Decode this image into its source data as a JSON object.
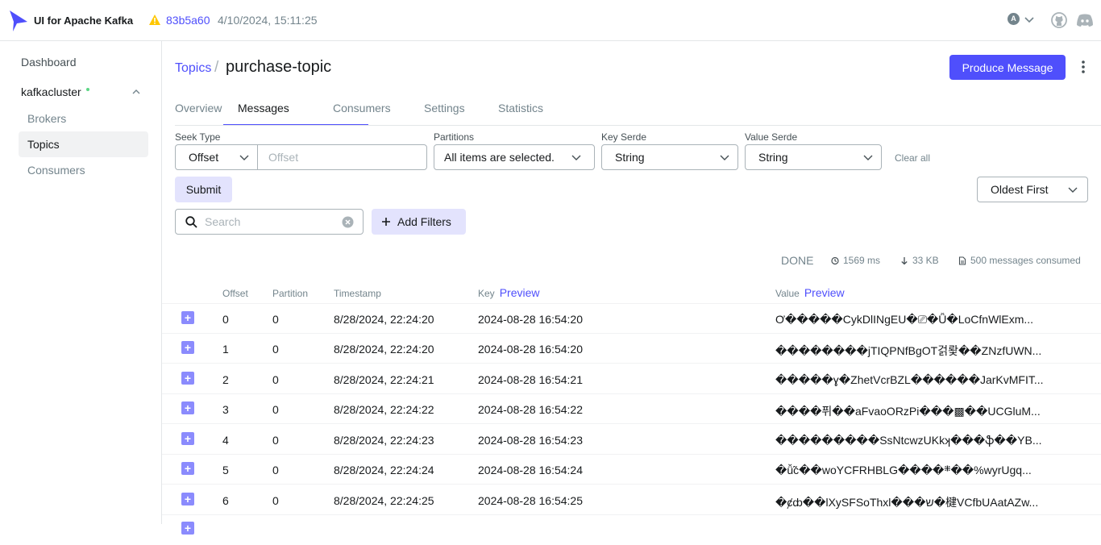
{
  "app": {
    "title": "UI for Apache Kafka",
    "commit": "83b5a60",
    "build_date": "4/10/2024, 15:11:25",
    "user_initial": "A"
  },
  "sidebar": {
    "dashboard": "Dashboard",
    "cluster": "kafkacluster",
    "items": [
      "Brokers",
      "Topics",
      "Consumers"
    ],
    "active_item": "Topics"
  },
  "header": {
    "breadcrumb": "Topics",
    "separator": "/",
    "title": "purchase-topic",
    "produce_label": "Produce Message"
  },
  "tabs": [
    "Overview",
    "Messages",
    "Consumers",
    "Settings",
    "Statistics"
  ],
  "active_tab": "Messages",
  "controls": {
    "seek_type_label": "Seek Type",
    "seek_type_value": "Offset",
    "offset_placeholder": "Offset",
    "partitions_label": "Partitions",
    "partitions_value": "All items are selected.",
    "key_serde_label": "Key Serde",
    "key_serde_value": "String",
    "value_serde_label": "Value Serde",
    "value_serde_value": "String",
    "clear_all": "Clear all",
    "submit_label": "Submit",
    "sort_value": "Oldest First",
    "search_placeholder": "Search",
    "add_filters_label": "Add Filters"
  },
  "stats": {
    "status": "DONE",
    "elapsed": "1569 ms",
    "bytes": "33 KB",
    "consumed": "500 messages consumed"
  },
  "table": {
    "columns": {
      "offset": "Offset",
      "partition": "Partition",
      "timestamp": "Timestamp",
      "key": "Key",
      "value": "Value",
      "preview": "Preview"
    },
    "rows": [
      {
        "offset": "0",
        "partition": "0",
        "timestamp": "8/28/2024, 22:24:20",
        "key": "2024-08-28 16:54:20",
        "value": "Ơ�����CykDlINgEU�⎚�Ǚ�LoCfnWlExm..."
      },
      {
        "offset": "1",
        "partition": "0",
        "timestamp": "8/28/2024, 22:24:20",
        "key": "2024-08-28 16:54:20",
        "value": "��������jTIQPNfBgOT걹뢏��ZNzfUWN..."
      },
      {
        "offset": "2",
        "partition": "0",
        "timestamp": "8/28/2024, 22:24:21",
        "key": "2024-08-28 16:54:21",
        "value": "�����ɣ�ZhetVcrBZL������JarKvMFIT..."
      },
      {
        "offset": "3",
        "partition": "0",
        "timestamp": "8/28/2024, 22:24:22",
        "key": "2024-08-28 16:54:22",
        "value": "����퓌��aFvaoORzPi���▩��UCGluM..."
      },
      {
        "offset": "4",
        "partition": "0",
        "timestamp": "8/28/2024, 22:24:23",
        "key": "2024-08-28 16:54:23",
        "value": "���������SsNtcwzUKkʞ���ֆ��YB..."
      },
      {
        "offset": "5",
        "partition": "0",
        "timestamp": "8/28/2024, 22:24:24",
        "key": "2024-08-28 16:54:24",
        "value": "�ǚ̃c��woYCFRHBLG����܍��%wyrUgq..."
      },
      {
        "offset": "6",
        "partition": "0",
        "timestamp": "8/28/2024, 22:24:25",
        "key": "2024-08-28 16:54:25",
        "value": "�ȼȸ��lXySFSoThxl���ש�楗VCfbUAatAZw..."
      }
    ]
  },
  "colors": {
    "accent": "#4f4ffc",
    "accent_light": "#e3e3fd",
    "expand_icon": "#8b8bfd",
    "status_ok": "#5cd685",
    "warning": "#ffc700"
  }
}
